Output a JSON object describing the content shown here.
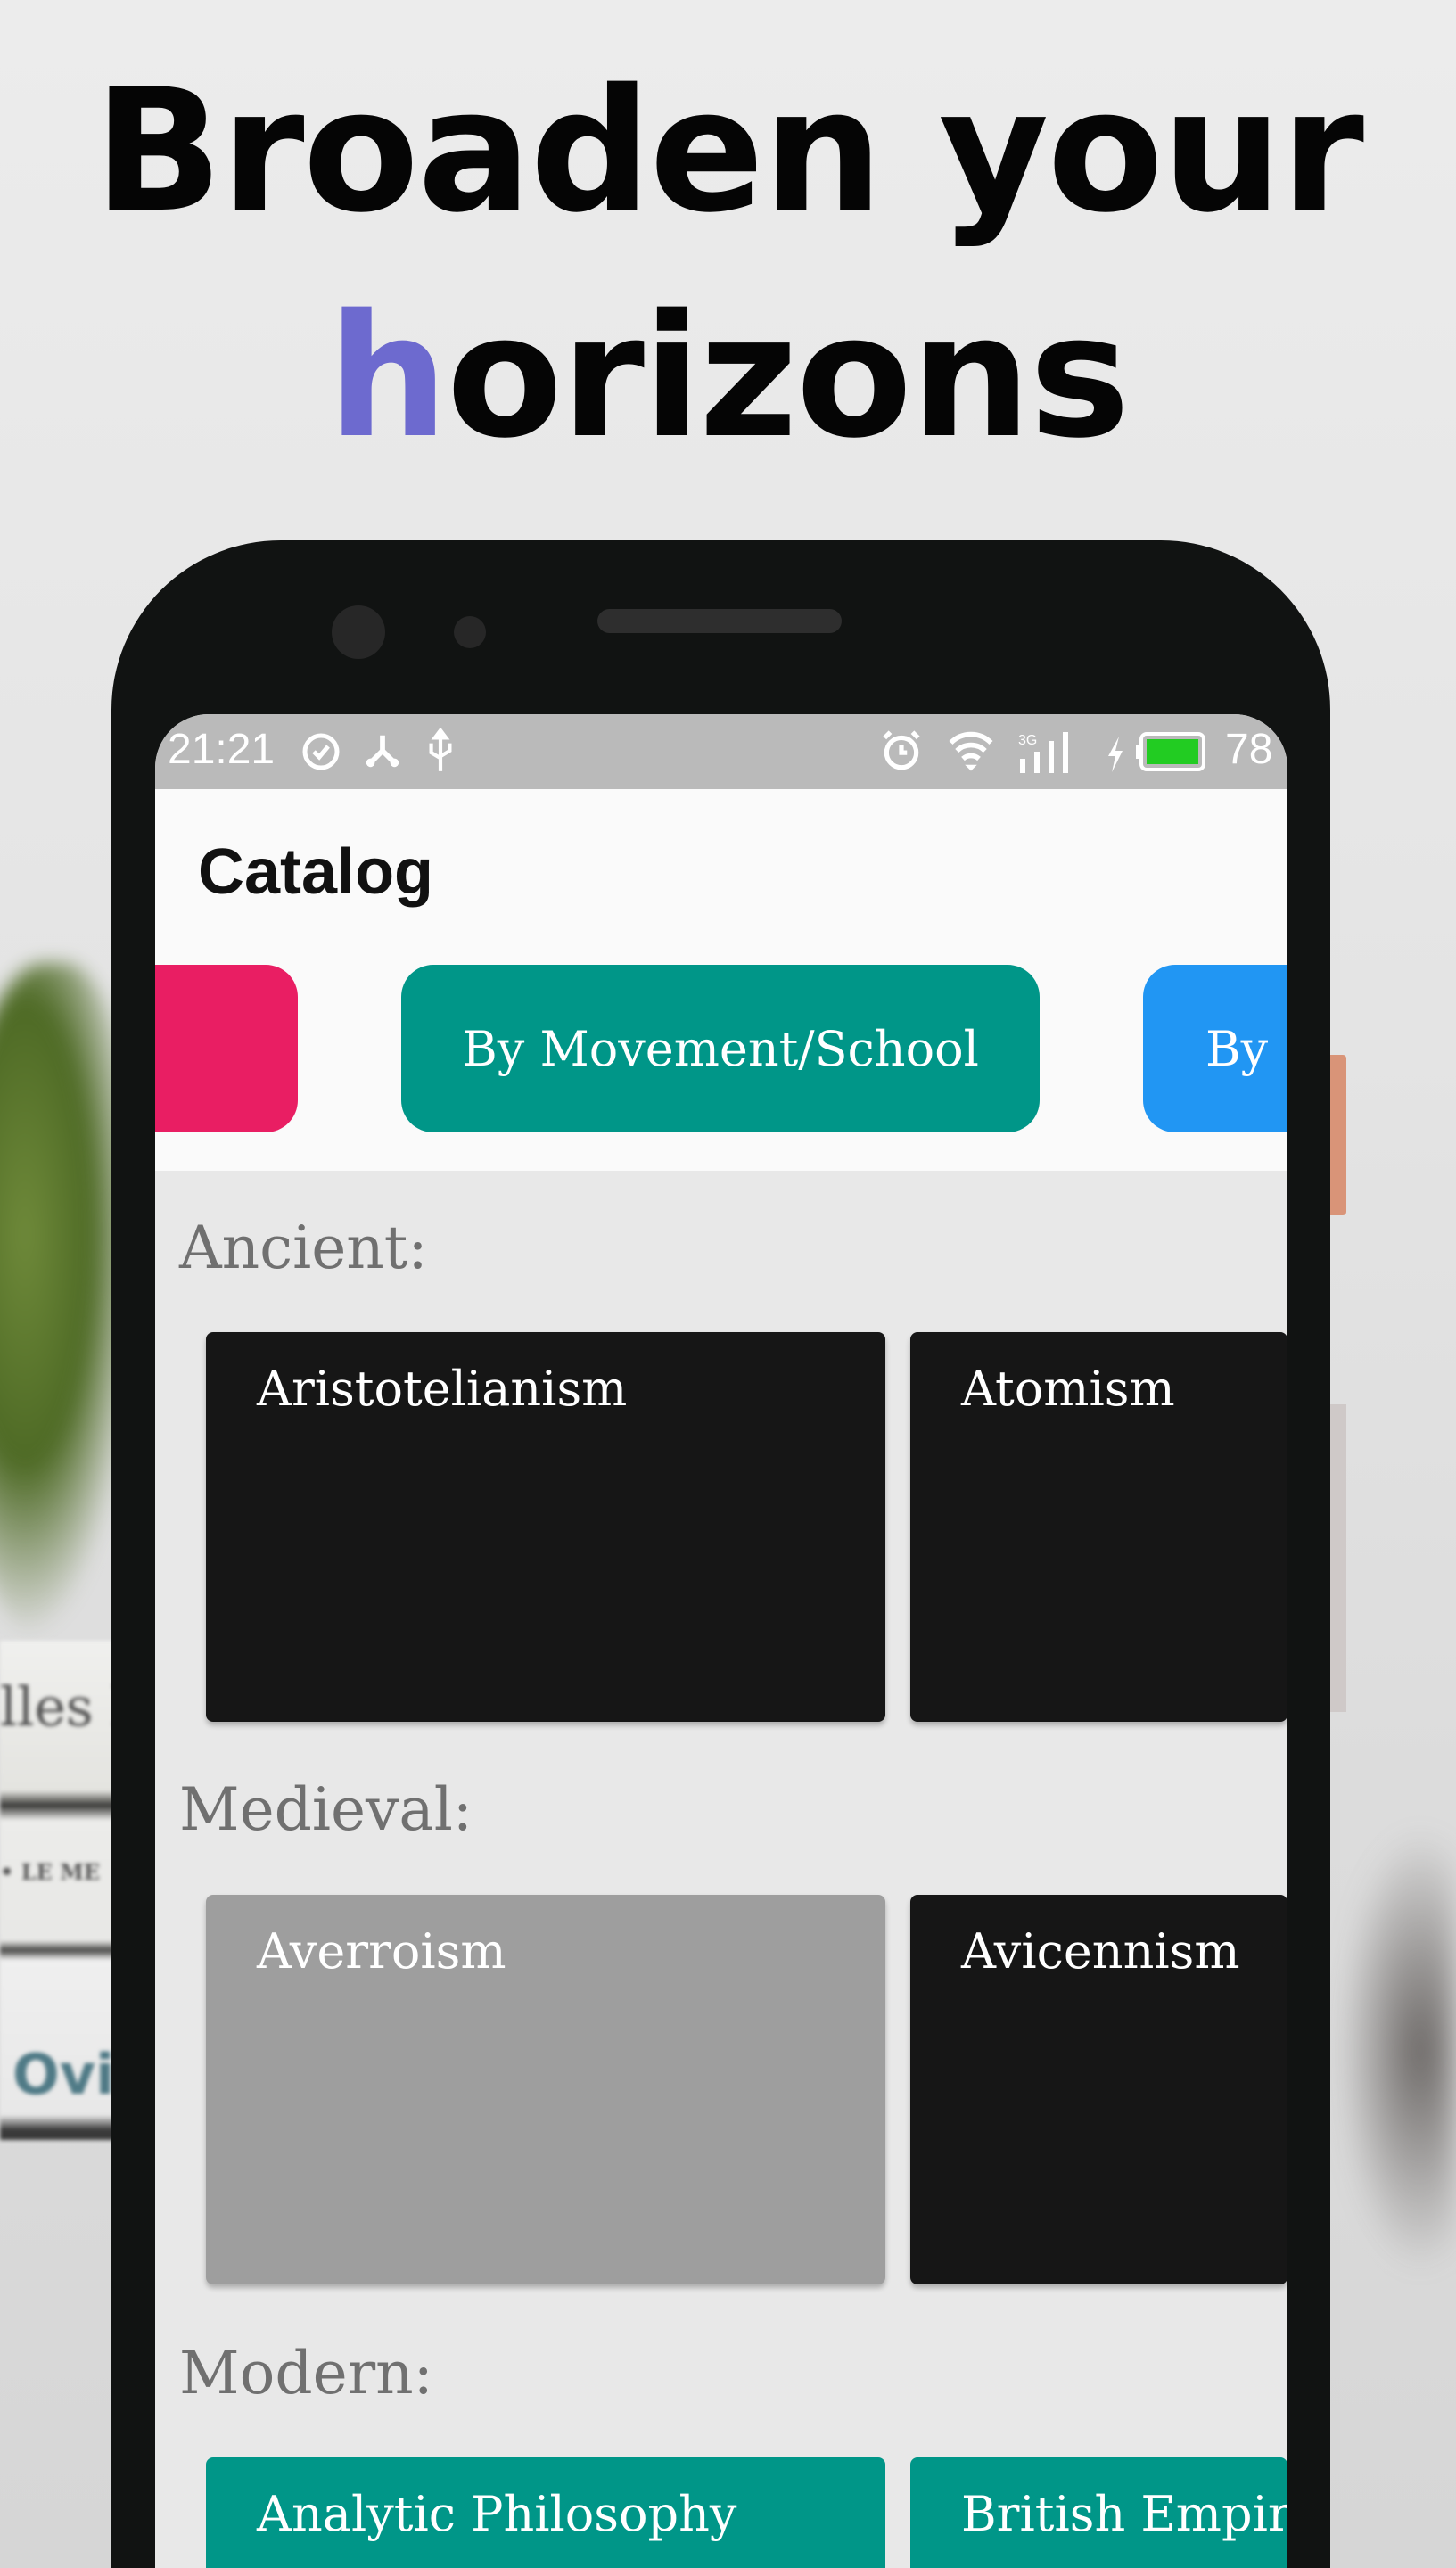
{
  "headline": {
    "line1": "Broaden your",
    "line2_accent": "h",
    "line2_rest": "orizons",
    "accent_color": "#6d6acf"
  },
  "background_text": [
    "lles hi",
    "• LE ME",
    "Ovid"
  ],
  "status_bar": {
    "time": "21:21",
    "battery": "78",
    "icons": [
      "check-circle-icon",
      "share-icon",
      "usb-icon",
      "alarm-icon",
      "wifi-icon",
      "signal-3g-icon",
      "charging-icon",
      "battery-icon"
    ]
  },
  "app": {
    "title": "Catalog",
    "chips": [
      {
        "label": "",
        "color": "#e91e63"
      },
      {
        "label": "By Movement/School",
        "color": "#009688"
      },
      {
        "label": "By",
        "color": "#2196f3"
      }
    ],
    "sections": [
      {
        "label": "Ancient:",
        "cards": [
          {
            "label": "Aristotelianism",
            "color": "#161616"
          },
          {
            "label": "Atomism",
            "color": "#161616"
          }
        ]
      },
      {
        "label": "Medieval:",
        "cards": [
          {
            "label": "Averroism",
            "color": "#9e9e9e"
          },
          {
            "label": "Avicennism",
            "color": "#161616"
          }
        ]
      },
      {
        "label": "Modern:",
        "cards": [
          {
            "label": "Analytic Philosophy",
            "color": "#009688"
          },
          {
            "label": "British Empir",
            "color": "#009688"
          }
        ]
      }
    ]
  }
}
